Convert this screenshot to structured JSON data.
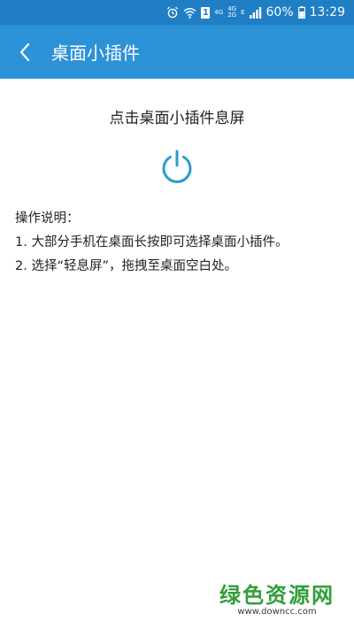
{
  "status_bar": {
    "icons": [
      "alarm-icon",
      "wifi-icon",
      "sim-1-icon",
      "4g-icon",
      "4g-2g-icon",
      "e-icon",
      "signal-icon",
      "battery-icon"
    ],
    "net_4g": "4G",
    "net_4g_top": "4G",
    "net_2g_bottom": "2G",
    "net_e": "E",
    "sim_label": "1",
    "battery": "60%",
    "time": "13:29"
  },
  "header": {
    "title": "桌面小插件"
  },
  "main": {
    "headline": "点击桌面小插件息屏",
    "instructions_title": "操作说明：",
    "steps": [
      "1. 大部分手机在桌面长按即可选择桌面小插件。",
      "2. 选择“轻息屏”，拖拽至桌面空白处。"
    ]
  },
  "watermark": {
    "brand": "绿色资源网",
    "url": "www.downcc.com"
  },
  "colors": {
    "status_bar": "#1f7ec4",
    "app_bar": "#2e93d6",
    "power_icon": "#2e9ad0",
    "watermark_green": "#2f9e3a"
  }
}
